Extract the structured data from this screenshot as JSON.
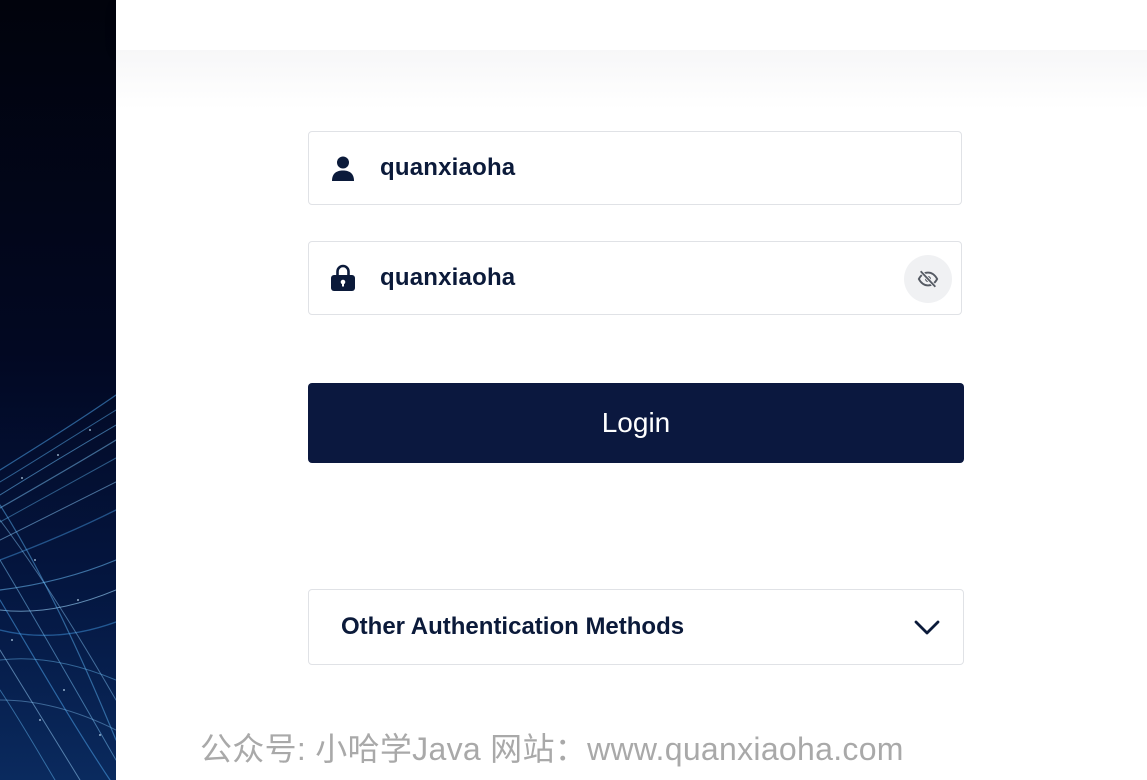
{
  "login_form": {
    "username_value": "quanxiaoha",
    "password_value": "quanxiaoha",
    "login_label": "Login",
    "other_auth_label": "Other Authentication Methods"
  },
  "icons": {
    "username": "user-icon",
    "password": "lock-icon",
    "toggle_visibility": "eye-slash-icon",
    "expand": "chevron-down-icon"
  },
  "colors": {
    "primary": "#0b183f",
    "text": "#0b1a3a",
    "border": "#e0e2e6"
  },
  "watermark": {
    "text": "公众号: 小哈学Java  网站：www.quanxiaoha.com"
  }
}
